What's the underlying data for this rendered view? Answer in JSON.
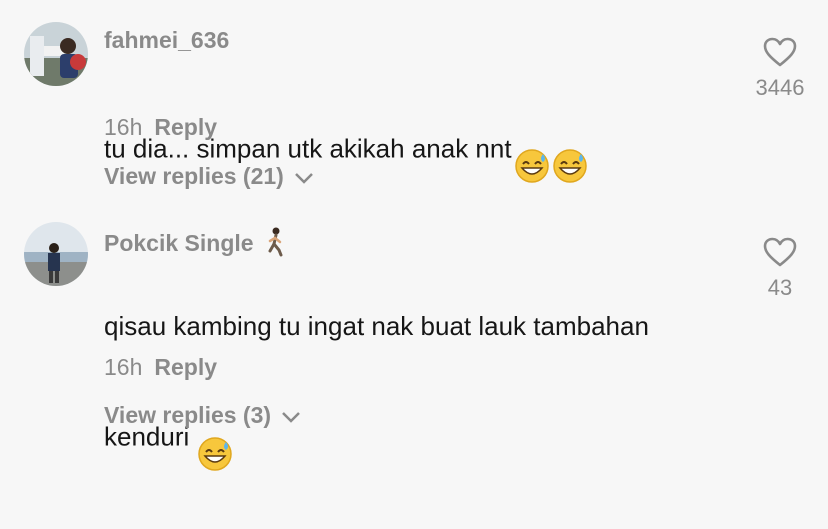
{
  "comments": [
    {
      "username": "fahmei_636",
      "text": "tu dia... simpan utk akikah anak nnt",
      "emojis": [
        "grinning-sweat-emoji",
        "grinning-sweat-emoji"
      ],
      "time": "16h",
      "reply_label": "Reply",
      "view_replies": "View replies (21)",
      "likes": "3446"
    },
    {
      "username": "Pokcik Single",
      "username_emoji": "person-walking-emoji",
      "text_line1": "qisau kambing tu ingat nak buat lauk tambahan",
      "text_line2": "kenduri",
      "emojis": [
        "grinning-sweat-emoji"
      ],
      "time": "16h",
      "reply_label": "Reply",
      "view_replies": "View replies (3)",
      "likes": "43"
    }
  ]
}
